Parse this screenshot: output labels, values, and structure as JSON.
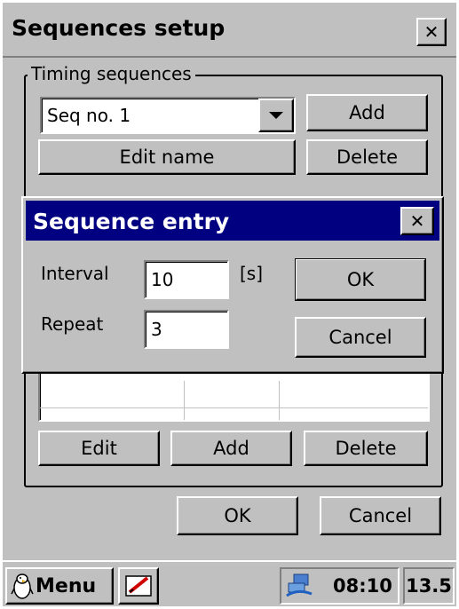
{
  "window": {
    "title": "Sequences setup",
    "close_glyph": "✕",
    "group_title": "Timing sequences",
    "sequence_select_value": "Seq no. 1",
    "add_label": "Add",
    "edit_name_label": "Edit name",
    "delete_label": "Delete",
    "table_rows": [
      [
        "",
        "",
        ""
      ],
      [
        "",
        "",
        ""
      ]
    ],
    "edit_label": "Edit",
    "entry_add_label": "Add",
    "entry_delete_label": "Delete",
    "ok_label": "OK",
    "cancel_label": "Cancel"
  },
  "dialog": {
    "title": "Sequence entry",
    "title_color": "#000080",
    "close_glyph": "✕",
    "interval_label": "Interval",
    "interval_value": "10",
    "interval_unit": "[s]",
    "repeat_label": "Repeat",
    "repeat_value": "3",
    "ok_label": "OK",
    "cancel_label": "Cancel"
  },
  "taskbar": {
    "menu_label": "Menu",
    "time": "08:10",
    "value": "13.5",
    "icons": [
      "penguin-icon",
      "pen-tablet-icon",
      "network-icon"
    ]
  }
}
